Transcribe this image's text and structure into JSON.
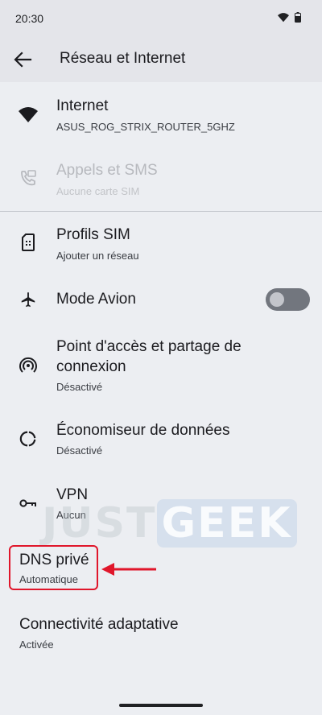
{
  "status_bar": {
    "time": "20:30"
  },
  "header": {
    "title": "Réseau et Internet"
  },
  "items": [
    {
      "title": "Internet",
      "subtitle": "ASUS_ROG_STRIX_ROUTER_5GHZ"
    },
    {
      "title": "Appels et SMS",
      "subtitle": "Aucune carte SIM"
    },
    {
      "title": "Profils SIM",
      "subtitle": "Ajouter un réseau"
    },
    {
      "title": "Mode Avion"
    },
    {
      "title_line1": "Point d'accès et partage de",
      "title_line2": "connexion",
      "subtitle": "Désactivé"
    },
    {
      "title": "Économiseur de données",
      "subtitle": "Désactivé"
    },
    {
      "title": "VPN",
      "subtitle": "Aucun"
    },
    {
      "title": "DNS privé",
      "subtitle": "Automatique"
    },
    {
      "title": "Connectivité adaptative",
      "subtitle": "Activée"
    }
  ],
  "airplane_mode": {
    "enabled": false
  },
  "watermark": {
    "part1": "JUST",
    "part2": "GEEK"
  },
  "annotation": {
    "color": "#e0162b"
  },
  "colors": {
    "background": "#eceef2",
    "toggle_track": "#72767e",
    "disabled_text": "#b7b9be"
  }
}
